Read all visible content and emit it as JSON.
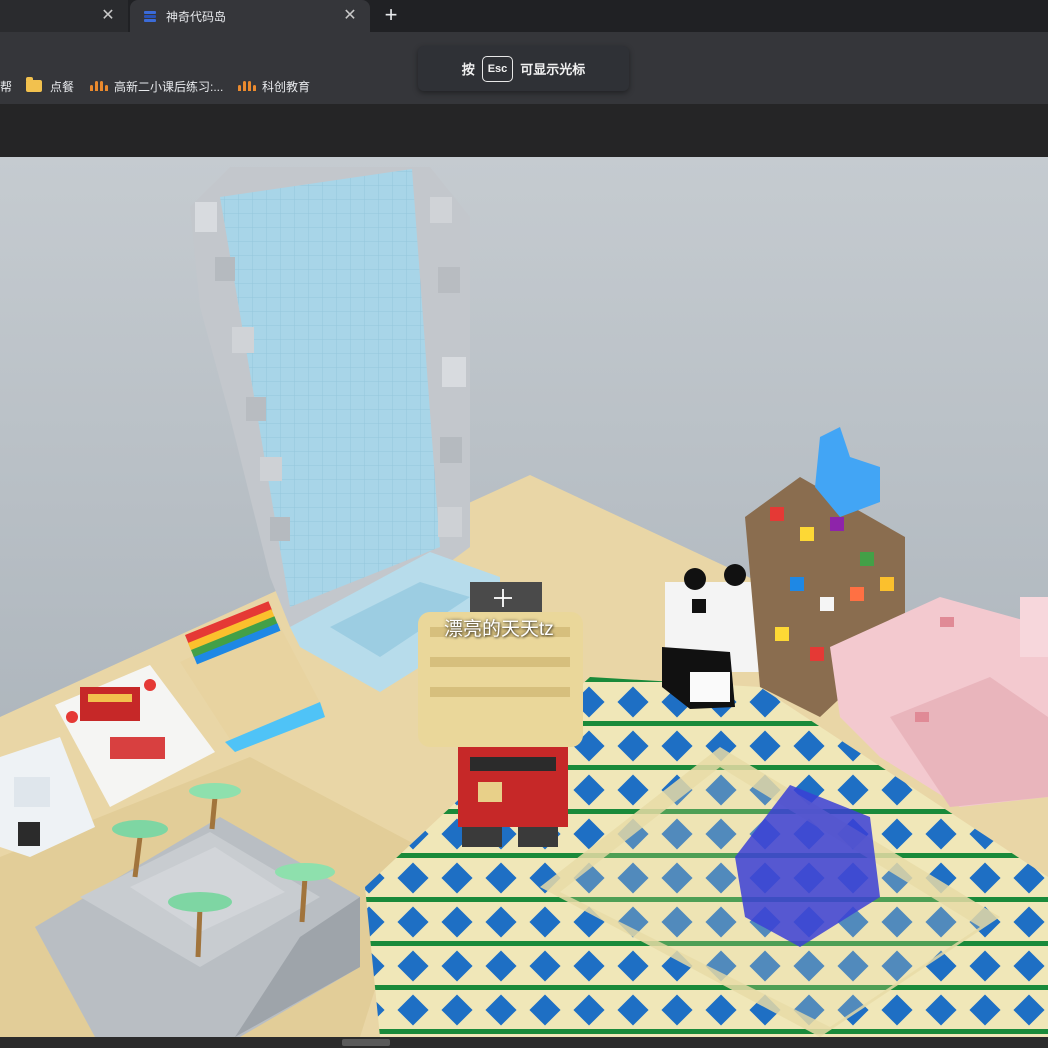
{
  "tabs": [
    {
      "label": "",
      "active": false
    },
    {
      "label": "神奇代码岛",
      "active": true
    }
  ],
  "new_tab_icon": "plus-icon",
  "toast": {
    "before": "按",
    "key": "Esc",
    "after": "可显示光标"
  },
  "bookmarks": [
    {
      "label": "帮",
      "icon": "none"
    },
    {
      "label": "点餐",
      "icon": "folder-icon"
    },
    {
      "label": "高新二小课后练习:...",
      "icon": "m-logo-icon"
    },
    {
      "label": "科创教育",
      "icon": "m-logo-icon"
    }
  ],
  "game": {
    "player_name": "漂亮的天天tz"
  },
  "colors": {
    "tab_active": "#35363a",
    "toolbar": "#35363a",
    "sky": "#b4bcc2",
    "sand": "#e9d6a6",
    "water": "#a9d6e8"
  }
}
